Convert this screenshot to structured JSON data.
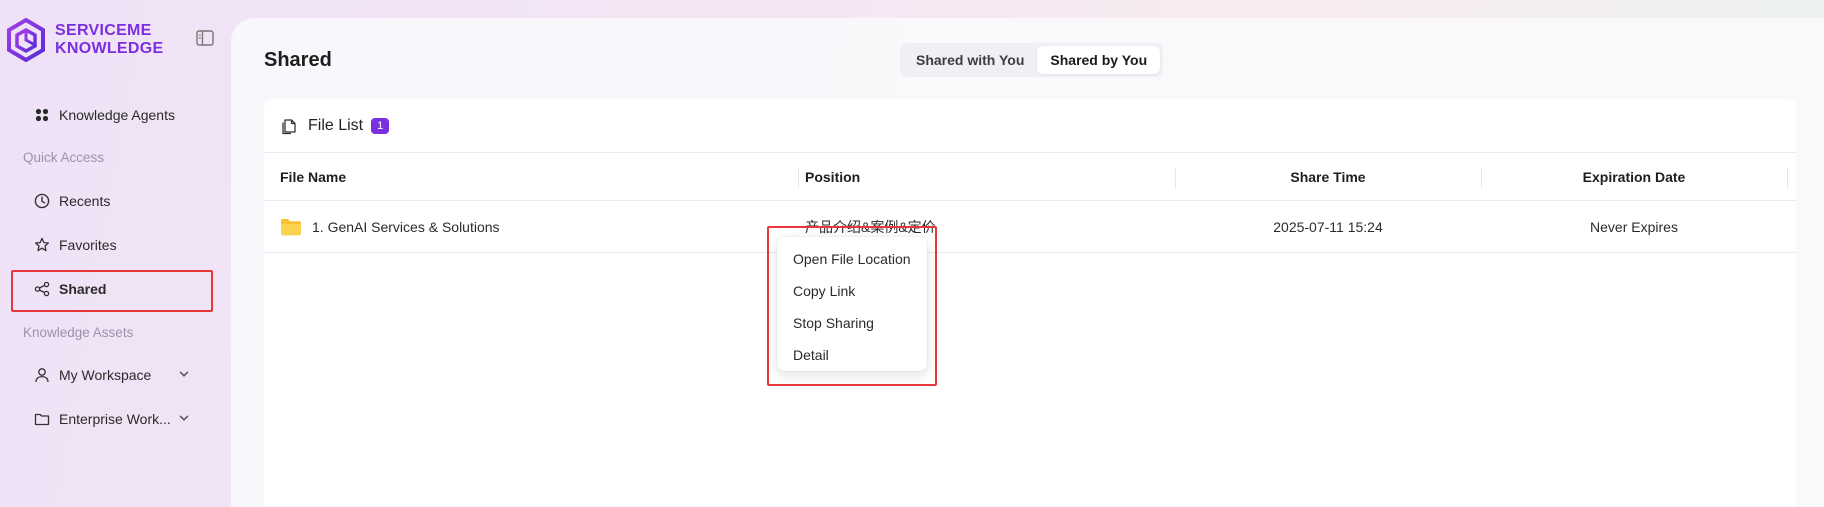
{
  "brand": {
    "line1": "SERVICEME",
    "line2": "KNOWLEDGE",
    "color": "#7b2fe0"
  },
  "sidebar": {
    "knowledge_agents": "Knowledge Agents",
    "quick_access_label": "Quick Access",
    "recents": "Recents",
    "favorites": "Favorites",
    "shared": "Shared",
    "knowledge_assets_label": "Knowledge Assets",
    "my_workspace": "My Workspace",
    "enterprise_workspace": "Enterprise Work..."
  },
  "page": {
    "title": "Shared"
  },
  "tabs": [
    {
      "label": "Shared with You",
      "active": false
    },
    {
      "label": "Shared by You",
      "active": true
    }
  ],
  "file_list": {
    "title": "File List",
    "count": "1",
    "columns": [
      "File Name",
      "Position",
      "Share Time",
      "Expiration Date"
    ],
    "rows": [
      {
        "file_name": "1. GenAI Services & Solutions",
        "position": "产品介绍&案例&定价",
        "share_time": "2025-07-11 15:24",
        "expiration": "Never Expires",
        "icon": "folder-icon"
      }
    ]
  },
  "context_menu": {
    "items": [
      "Open File Location",
      "Copy Link",
      "Stop Sharing",
      "Detail"
    ]
  },
  "colors": {
    "accent": "#7b2fe0",
    "highlight": "#e5383b",
    "folder": "#f6c130"
  }
}
